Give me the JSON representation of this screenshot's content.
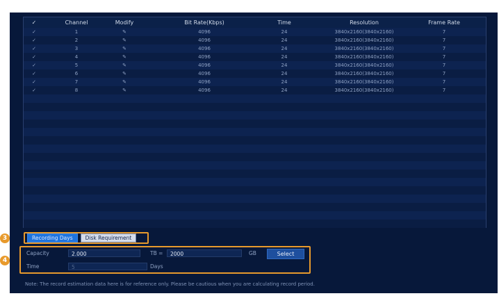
{
  "table": {
    "columns": [
      "✓",
      "Channel",
      "Modify",
      "Bit Rate(Kbps)",
      "Time",
      "Resolution",
      "Frame Rate"
    ],
    "rows": [
      {
        "check": "✓",
        "channel": "1",
        "modify": "✎",
        "bitrate": "4096",
        "time": "24",
        "resolution": "3840x2160(3840x2160)",
        "frame_rate": "7"
      },
      {
        "check": "✓",
        "channel": "2",
        "modify": "✎",
        "bitrate": "4096",
        "time": "24",
        "resolution": "3840x2160(3840x2160)",
        "frame_rate": "7"
      },
      {
        "check": "✓",
        "channel": "3",
        "modify": "✎",
        "bitrate": "4096",
        "time": "24",
        "resolution": "3840x2160(3840x2160)",
        "frame_rate": "7"
      },
      {
        "check": "✓",
        "channel": "4",
        "modify": "✎",
        "bitrate": "4096",
        "time": "24",
        "resolution": "3840x2160(3840x2160)",
        "frame_rate": "7"
      },
      {
        "check": "✓",
        "channel": "5",
        "modify": "✎",
        "bitrate": "4096",
        "time": "24",
        "resolution": "3840x2160(3840x2160)",
        "frame_rate": "7"
      },
      {
        "check": "✓",
        "channel": "6",
        "modify": "✎",
        "bitrate": "4096",
        "time": "24",
        "resolution": "3840x2160(3840x2160)",
        "frame_rate": "7"
      },
      {
        "check": "✓",
        "channel": "7",
        "modify": "✎",
        "bitrate": "4096",
        "time": "24",
        "resolution": "3840x2160(3840x2160)",
        "frame_rate": "7"
      },
      {
        "check": "✓",
        "channel": "8",
        "modify": "✎",
        "bitrate": "4096",
        "time": "24",
        "resolution": "3840x2160(3840x2160)",
        "frame_rate": "7"
      }
    ]
  },
  "tabs": {
    "recording_days": "Recording Days",
    "disk_requirement": "Disk Requirement"
  },
  "form": {
    "capacity_label": "Capacity",
    "capacity_tb": "2.000",
    "tb_unit": "TB =",
    "capacity_gb": "2000",
    "gb_unit": "GB",
    "select_label": "Select",
    "time_label": "Time",
    "time_value": "5",
    "days_unit": "Days"
  },
  "note": "Note: The record estimation data here is for reference only. Please be cautious when you are calculating record period.",
  "markers": {
    "tabs_marker": "3",
    "form_marker": "4"
  },
  "colors": {
    "background": "#07183a",
    "highlight_border": "#e89a2c",
    "active_tab": "#1e74df"
  },
  "icons": {
    "check": "check-icon",
    "modify": "pencil-icon"
  }
}
